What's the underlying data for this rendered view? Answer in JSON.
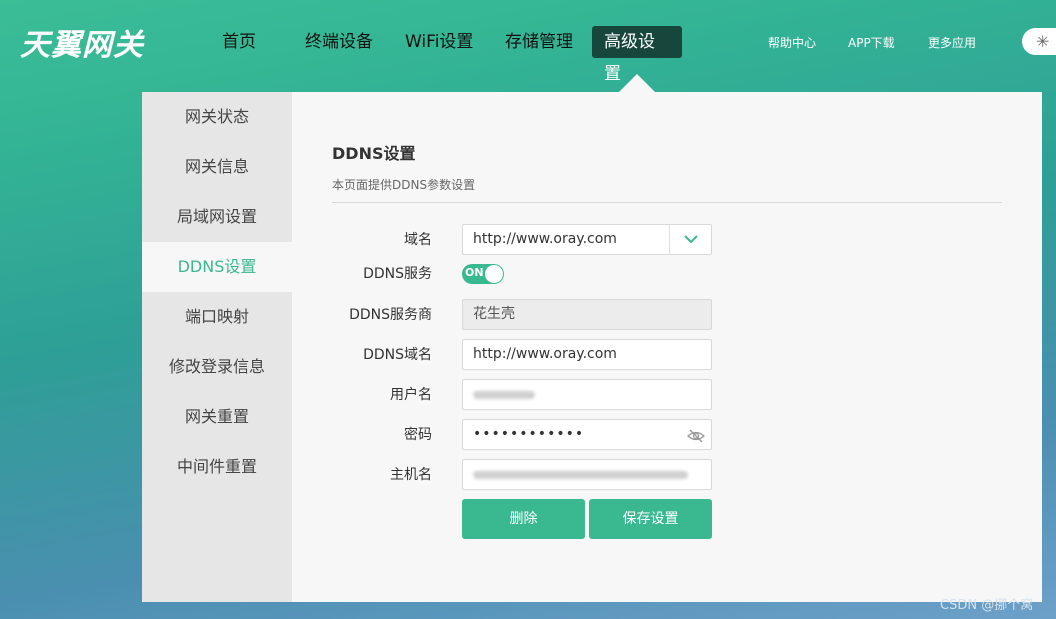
{
  "brand": {
    "logo_text": "天翼网关"
  },
  "nav": {
    "items": [
      "首页",
      "终端设备",
      "WiFi设置",
      "存储管理",
      "高级设置"
    ],
    "active": "高级设置",
    "links": [
      "帮助中心",
      "APP下载",
      "更多应用"
    ]
  },
  "sidebar": {
    "items": [
      "网关状态",
      "网关信息",
      "局域网设置",
      "DDNS设置",
      "端口映射",
      "修改登录信息",
      "网关重置",
      "中间件重置"
    ],
    "active": "DDNS设置"
  },
  "page": {
    "title": "DDNS设置",
    "description": "本页面提供DDNS参数设置"
  },
  "form": {
    "domain_label": "域名",
    "domain_value": "http://www.oray.com",
    "ddns_service_label": "DDNS服务",
    "ddns_service_state": "ON",
    "provider_label": "DDNS服务商",
    "provider_value": "花生壳",
    "ddns_domain_label": "DDNS域名",
    "ddns_domain_value": "http://www.oray.com",
    "username_label": "用户名",
    "password_label": "密码",
    "password_mask": "••••••••••••",
    "hostname_label": "主机名"
  },
  "buttons": {
    "delete": "删除",
    "save": "保存设置"
  },
  "watermark": "CSDN @挪个窝",
  "colors": {
    "accent": "#3ab88f",
    "nav_active_bg": "#17463d",
    "sidebar_bg": "#e6e6e6",
    "panel_bg": "#f7f7f7"
  }
}
